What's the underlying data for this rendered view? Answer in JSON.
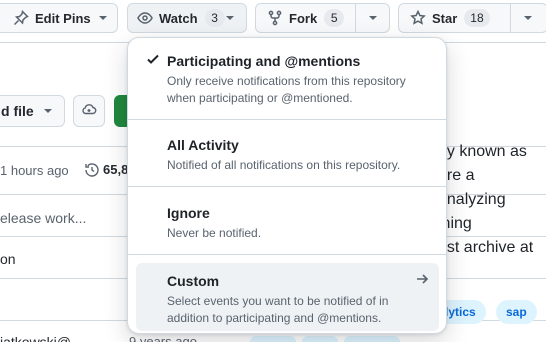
{
  "toolbar": {
    "edit_pins_label": "Edit Pins",
    "watch_label": "Watch",
    "watch_count": "3",
    "fork_label": "Fork",
    "fork_count": "5",
    "star_label": "Star",
    "star_count": "18"
  },
  "background": {
    "add_file_fragment": "d file",
    "time_fragment": "1 hours ago",
    "commits_fragment": "65,8",
    "row1_fragment": "elease work...",
    "row2_fragment": "on",
    "row3_fragment": "iatkowski@",
    "row3_time_fragment": "9 years ago",
    "about_lines": [
      "rly known as",
      "are a",
      "analyzing",
      "ining",
      "ust archive at"
    ],
    "topics": [
      "lytics",
      "sap"
    ]
  },
  "watch_menu": {
    "options": [
      {
        "title": "Participating and @mentions",
        "description": "Only receive notifications from this repository when participating or @mentioned.",
        "selected": true
      },
      {
        "title": "All Activity",
        "description": "Notified of all notifications on this repository."
      },
      {
        "title": "Ignore",
        "description": "Never be notified."
      },
      {
        "title": "Custom",
        "description": "Select events you want to be notified of in addition to participating and @mentions."
      }
    ]
  },
  "colors": {
    "accent": "#0969da",
    "border": "#d1d9e0",
    "button_bg": "#f6f8fa",
    "hover_bg": "#eff2f5"
  }
}
